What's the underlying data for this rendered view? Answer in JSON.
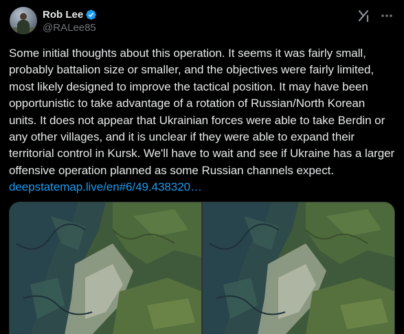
{
  "tweet": {
    "author": {
      "display_name": "Rob Lee",
      "handle": "@RALee85",
      "verified": true
    },
    "text_paragraph": "Some initial thoughts about this operation. It seems it was fairly small, probably battalion size or smaller, and the objectives were fairly limited, most likely designed to improve the tactical position. It may have been opportunistic to take advantage of a rotation of Russian/North Korean units. It does not appear that Ukrainian forces were able to take Berdin or any other villages, and it is unclear if they were able to expand their territorial control in Kursk. We'll have to wait and see if Ukraine has a larger offensive operation planned as some Russian channels expect.",
    "link_text": "deepstatemap.live/en#6/49.438320…",
    "media": [
      {
        "kind": "satellite-map"
      },
      {
        "kind": "satellite-map"
      }
    ]
  },
  "icons": {
    "verified": "verified-badge-icon",
    "grok": "grok-icon",
    "more": "more-options-icon"
  },
  "colors": {
    "background": "#000000",
    "text": "#e7e9ea",
    "secondary_text": "#71767b",
    "link": "#1d9bf0",
    "verified_badge": "#1d9bf0",
    "border": "#2f3336"
  }
}
